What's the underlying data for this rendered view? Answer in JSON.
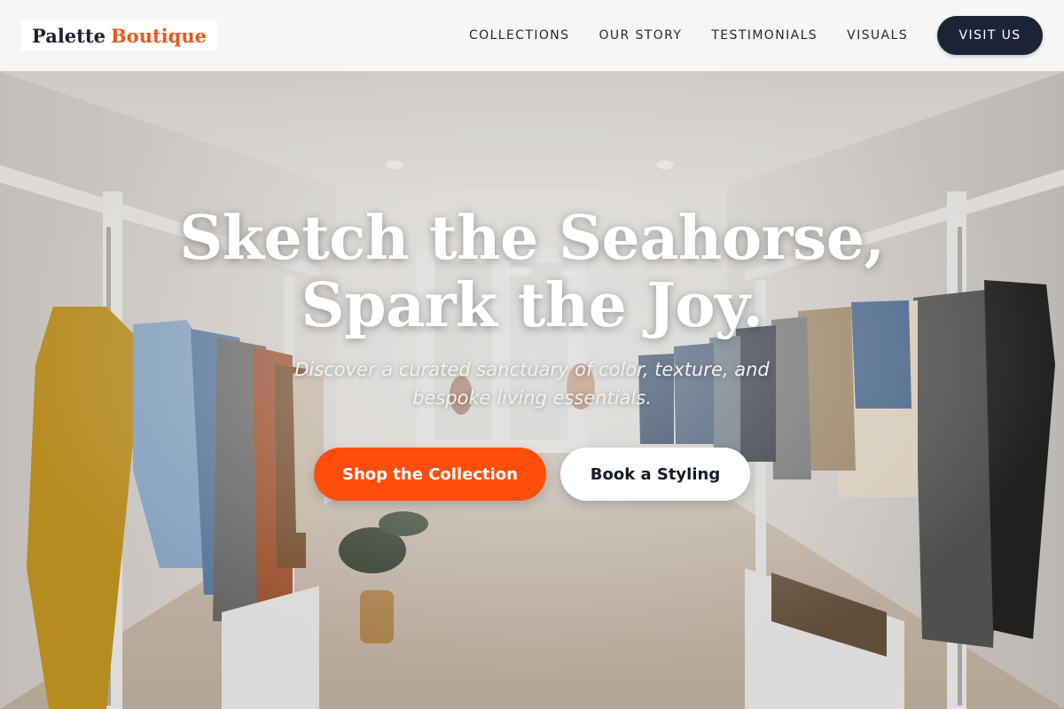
{
  "brand": {
    "name_first": "Palette",
    "name_second": "Boutique",
    "accent_color": "#e8581c",
    "navy_color": "#1b2436"
  },
  "nav": {
    "links": [
      {
        "label": "COLLECTIONS"
      },
      {
        "label": "OUR STORY"
      },
      {
        "label": "TESTIMONIALS"
      },
      {
        "label": "VISUALS"
      }
    ],
    "cta_label": "VISIT US"
  },
  "hero": {
    "title_line1": "Sketch the Seahorse,",
    "title_line2": "Spark the Joy.",
    "subtitle_line1": "Discover a curated sanctuary of color, texture, and",
    "subtitle_line2": "bespoke living essentials.",
    "primary_button": "Shop the Collection",
    "secondary_button": "Book a Styling",
    "primary_color": "#ff4d0d",
    "background_scene": "boutique-clothing-store-interior"
  }
}
